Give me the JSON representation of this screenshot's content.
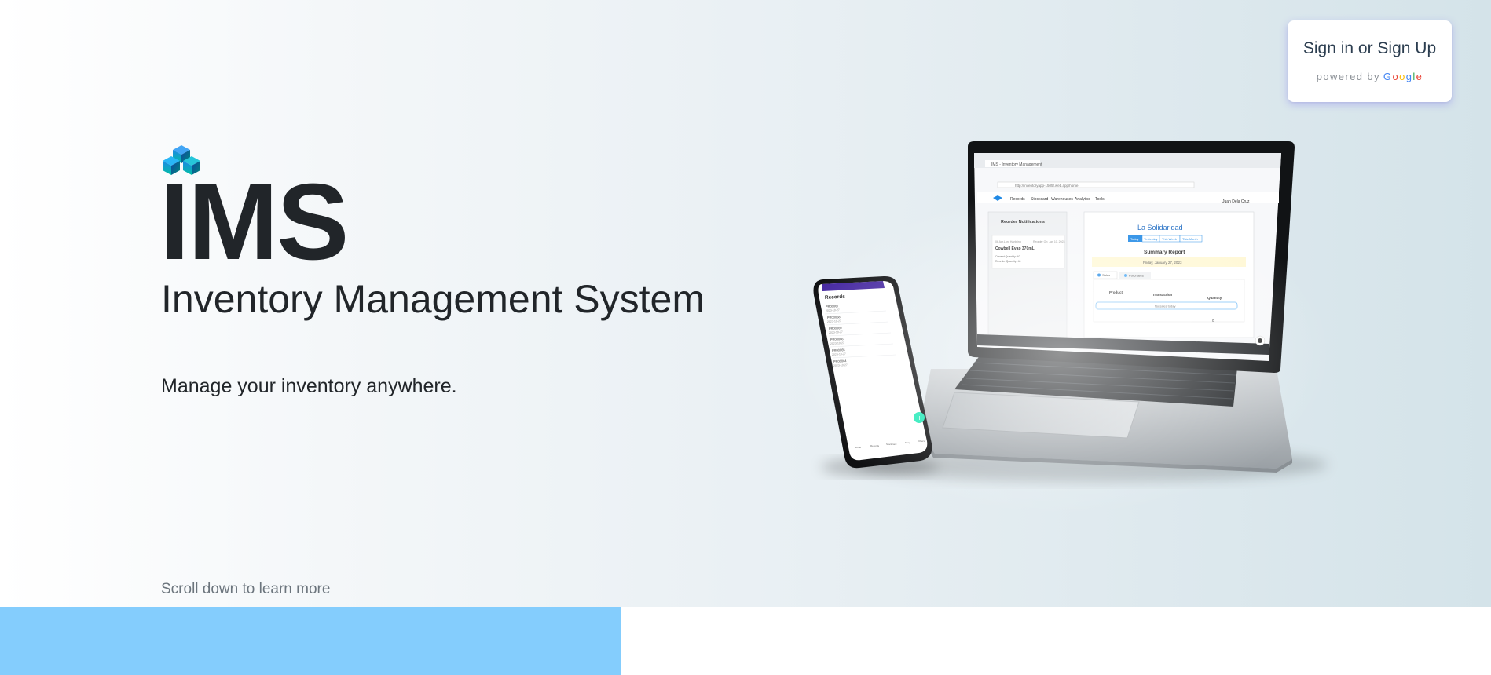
{
  "signin": {
    "title": "Sign in or Sign Up",
    "powered_by": "powered by",
    "google": {
      "g1": "G",
      "o1": "o",
      "o2": "o",
      "g2": "g",
      "l": "l",
      "e": "e"
    }
  },
  "brand": {
    "name": "IMS",
    "subtitle": "Inventory Management System",
    "tagline": "Manage your inventory anywhere."
  },
  "scroll_hint": "Scroll down to learn more",
  "colors": {
    "logo_cube_top": "#1e88e5",
    "logo_cube_bottom": "#00bfa5",
    "bottom_band": "#84cdfd",
    "signin_glow": "#7b6ff0"
  },
  "icons": {
    "logo": "stacked-cubes-icon"
  },
  "laptop_screen": {
    "tab_title": "IMS - Inventory Management",
    "url": "http://inventoryapp-1505f.web.app/home",
    "nav": [
      "Records",
      "Stockcard",
      "Warehouses",
      "Analytics",
      "Tools"
    ],
    "user": "Juan Dela Cruz",
    "reorder_title": "Reorder Notifications",
    "reorder_item_meta": "06 Apr.Lord Hanbling",
    "reorder_item_date": "Reorder On: Jan 10, 2023",
    "reorder_item_name": "Cowbell Evap 370mL",
    "reorder_current": "Current Quantity: 40",
    "reorder_level": "Reorder Quantity: 40",
    "store_name": "La Solidaridad",
    "period_tabs": [
      "Today",
      "Yesterday",
      "This Week",
      "This Month"
    ],
    "report_title": "Summary Report",
    "report_date": "Friday, January 27, 2023",
    "report_tabs": [
      "Sales",
      "Purchases"
    ],
    "table_headers": [
      "Product",
      "Transaction",
      "Quantity"
    ],
    "empty_message": "No sales today",
    "total": "0"
  },
  "phone_screen": {
    "title": "Records",
    "records": [
      {
        "id": "PR00067",
        "date": "2023-10-27"
      },
      {
        "id": "PR00068",
        "date": "2023-10-27"
      },
      {
        "id": "PR00069",
        "date": "2023-10-27"
      },
      {
        "id": "PR00066",
        "date": "2023-10-27"
      },
      {
        "id": "PR00065",
        "date": "2023-10-27"
      },
      {
        "id": "PR00064",
        "date": "2023-10-27"
      }
    ],
    "bottom_nav": [
      "Home",
      "Records",
      "Stockcard",
      "Shop",
      "Others"
    ]
  }
}
